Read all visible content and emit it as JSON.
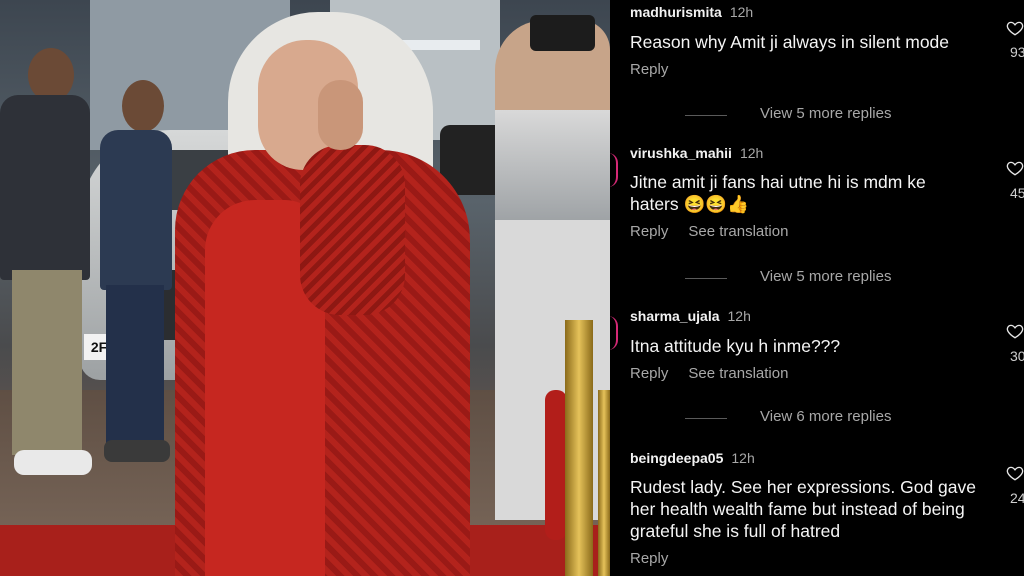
{
  "photo": {
    "plate_text": "2F"
  },
  "comments": [
    {
      "username": "madhurismita",
      "time": "12h",
      "text": "Reason why Amit ji always in silent mode",
      "reply": "Reply",
      "translation": "",
      "likes": "93",
      "story_ring": false,
      "view_more": "View 5 more replies"
    },
    {
      "username": "virushka_mahii",
      "time": "12h",
      "text": "Jitne amit ji fans hai utne hi is mdm ke haters 😆😆👍",
      "reply": "Reply",
      "translation": "See translation",
      "likes": "45",
      "story_ring": true,
      "view_more": "View 5 more replies"
    },
    {
      "username": "sharma_ujala",
      "time": "12h",
      "text": "Itna attitude kyu h inme???",
      "reply": "Reply",
      "translation": "See translation",
      "likes": "30",
      "story_ring": true,
      "view_more": "View 6 more replies"
    },
    {
      "username": "beingdeepa05",
      "time": "12h",
      "text": "Rudest lady. See her expressions. God gave her health wealth fame but instead of being grateful she is full of hatred",
      "reply": "Reply",
      "translation": "",
      "likes": "24",
      "story_ring": false,
      "view_more": ""
    }
  ],
  "icons": {
    "like": "heart-outline-icon"
  },
  "colors": {
    "panel_bg": "#000000",
    "secondary_text": "#a8a8a8",
    "story_ring": "#d62976",
    "dress_red": "#b3231c"
  }
}
